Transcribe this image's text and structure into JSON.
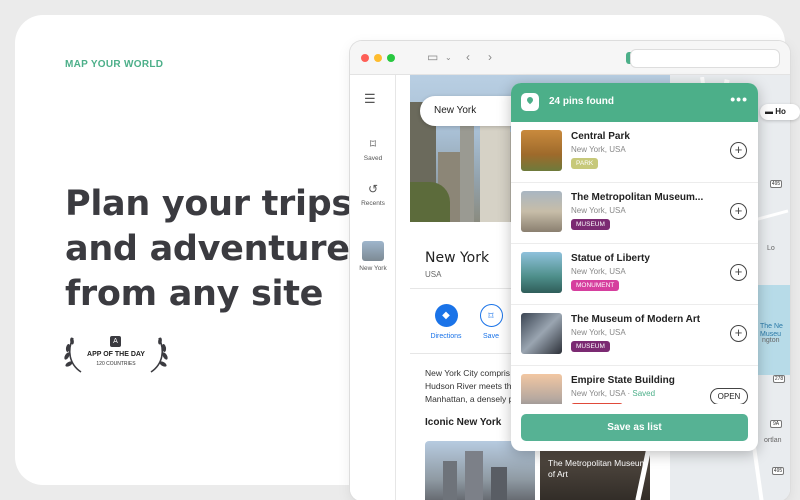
{
  "hero": {
    "eyebrow": "MAP YOUR WORLD",
    "headline": "Plan your trips and adventures from any site",
    "award_title": "APP OF THE DAY",
    "award_sub": "120 COUNTRIES"
  },
  "browser": {
    "rail": [
      {
        "label": "Saved",
        "icon": "bookmark-icon"
      },
      {
        "label": "Recents",
        "icon": "history-icon"
      },
      {
        "label": "New York",
        "icon": "thumbnail"
      }
    ]
  },
  "maps_panel": {
    "search_value": "New York",
    "place_name": "New York",
    "country": "USA",
    "actions": [
      {
        "label": "Directions",
        "icon": "directions-icon"
      },
      {
        "label": "Save",
        "icon": "bookmark-icon"
      }
    ],
    "description_lines": [
      "New York City compris",
      "Hudson River meets th",
      "Manhattan, a densely p"
    ],
    "section_title": "Iconic New York",
    "tile_caption": "The Metropolitan Museum of Art"
  },
  "map": {
    "hotels_chip": "Ho",
    "labels": [
      "Lo",
      "The Ne",
      "Museu",
      "ngton",
      "ortlan"
    ],
    "shields": [
      "495",
      "278",
      "9A",
      "495"
    ]
  },
  "popup": {
    "title": "24 pins found",
    "items": [
      {
        "name": "Central Park",
        "location": "New York, USA",
        "saved": "",
        "tag": "PARK",
        "tag_color": "#c7c97a",
        "action": "add"
      },
      {
        "name": "The Metropolitan Museum...",
        "location": "New York, USA",
        "saved": "",
        "tag": "MUSEUM",
        "tag_color": "#7b2a72",
        "action": "add"
      },
      {
        "name": "Statue of Liberty",
        "location": "New York, USA",
        "saved": "",
        "tag": "MONUMENT",
        "tag_color": "#d63f9e",
        "action": "add"
      },
      {
        "name": "The Museum of Modern Art",
        "location": "New York, USA",
        "saved": "",
        "tag": "MUSEUM",
        "tag_color": "#7b2a72",
        "action": "add"
      },
      {
        "name": "Empire State Building",
        "location": "New York, USA",
        "saved": "Saved",
        "tag": "",
        "tag_color": "#e04a3a",
        "action": "OPEN"
      }
    ],
    "save_button": "Save as list"
  },
  "colors": {
    "accent": "#4caf89",
    "button": "#56b294"
  }
}
